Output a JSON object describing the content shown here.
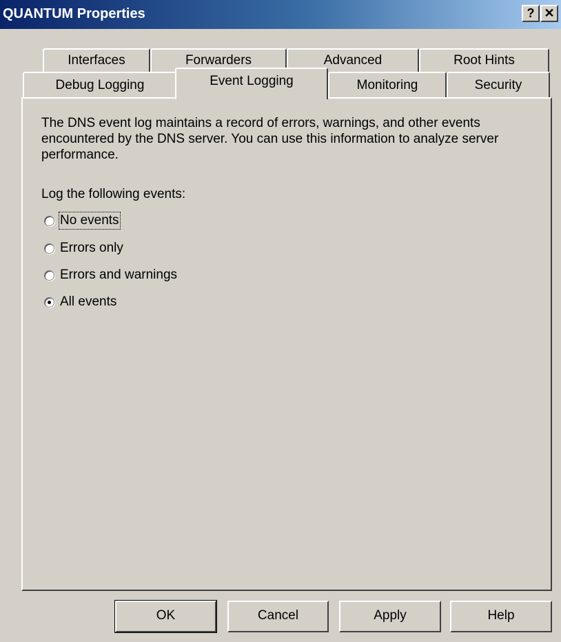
{
  "window": {
    "title": "QUANTUM Properties",
    "help_button": "?",
    "close_button": "✕"
  },
  "tabs_row1": [
    {
      "label": "Interfaces"
    },
    {
      "label": "Forwarders"
    },
    {
      "label": "Advanced"
    },
    {
      "label": "Root Hints"
    }
  ],
  "tabs_row2": [
    {
      "label": "Debug Logging"
    },
    {
      "label": "Event Logging",
      "active": true
    },
    {
      "label": "Monitoring"
    },
    {
      "label": "Security"
    }
  ],
  "panel": {
    "description": "The DNS event log maintains a record of errors, warnings, and other events encountered by the DNS server. You can use this information to analyze server performance.",
    "log_label": "Log the following events:",
    "options": [
      {
        "label": "No events",
        "checked": false
      },
      {
        "label": "Errors only",
        "checked": false
      },
      {
        "label": "Errors and warnings",
        "checked": false
      },
      {
        "label": "All events",
        "checked": true
      }
    ]
  },
  "buttons": {
    "ok": "OK",
    "cancel": "Cancel",
    "apply": "Apply",
    "help": "Help"
  }
}
